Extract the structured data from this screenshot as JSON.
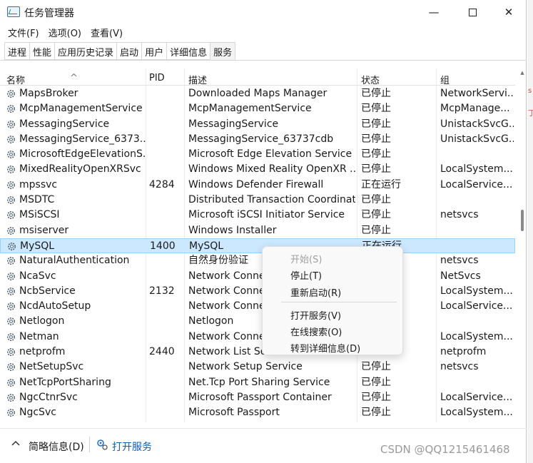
{
  "window": {
    "title": "任务管理器",
    "min_glyph": "—",
    "close_glyph": "✕"
  },
  "menu": [
    "文件(F)",
    "选项(O)",
    "查看(V)"
  ],
  "tabs": [
    {
      "label": "进程",
      "active": false
    },
    {
      "label": "性能",
      "active": false
    },
    {
      "label": "应用历史记录",
      "active": false
    },
    {
      "label": "启动",
      "active": false
    },
    {
      "label": "用户",
      "active": false
    },
    {
      "label": "详细信息",
      "active": false
    },
    {
      "label": "服务",
      "active": true
    }
  ],
  "columns": {
    "name": "名称",
    "pid": "PID",
    "desc": "描述",
    "status": "状态",
    "group": "组",
    "sort_glyph": "^"
  },
  "rows": [
    {
      "name": "MapsBroker",
      "pid": "",
      "desc": "Downloaded Maps Manager",
      "status": "已停止",
      "group": "NetworkServi..."
    },
    {
      "name": "McpManagementService",
      "pid": "",
      "desc": "McpManagementService",
      "status": "已停止",
      "group": "McpManage..."
    },
    {
      "name": "MessagingService",
      "pid": "",
      "desc": "MessagingService",
      "status": "已停止",
      "group": "UnistackSvcG..."
    },
    {
      "name": "MessagingService_6373...",
      "pid": "",
      "desc": "MessagingService_63737cdb",
      "status": "已停止",
      "group": "UnistackSvcG..."
    },
    {
      "name": "MicrosoftEdgeElevationS...",
      "pid": "",
      "desc": "Microsoft Edge Elevation Service ...",
      "status": "已停止",
      "group": ""
    },
    {
      "name": "MixedRealityOpenXRSvc",
      "pid": "",
      "desc": "Windows Mixed Reality OpenXR ...",
      "status": "已停止",
      "group": "LocalSystem..."
    },
    {
      "name": "mpssvc",
      "pid": "4284",
      "desc": "Windows Defender Firewall",
      "status": "正在运行",
      "group": "LocalService..."
    },
    {
      "name": "MSDTC",
      "pid": "",
      "desc": "Distributed Transaction Coordinat...",
      "status": "已停止",
      "group": ""
    },
    {
      "name": "MSiSCSI",
      "pid": "",
      "desc": "Microsoft iSCSI Initiator Service",
      "status": "已停止",
      "group": "netsvcs"
    },
    {
      "name": "msiserver",
      "pid": "",
      "desc": "Windows Installer",
      "status": "已停止",
      "group": ""
    },
    {
      "name": "MySQL",
      "pid": "1400",
      "desc": "MySQL",
      "status": "正在运行",
      "group": "",
      "selected": true
    },
    {
      "name": "NaturalAuthentication",
      "pid": "",
      "desc": "自然身份验证",
      "status": "",
      "group": "netsvcs"
    },
    {
      "name": "NcaSvc",
      "pid": "",
      "desc": "Network Conne...",
      "status": "",
      "group": "NetSvcs"
    },
    {
      "name": "NcbService",
      "pid": "2132",
      "desc": "Network Conne...",
      "status": "",
      "group": "LocalSystem..."
    },
    {
      "name": "NcdAutoSetup",
      "pid": "",
      "desc": "Network Conne...",
      "status": "",
      "group": "LocalService..."
    },
    {
      "name": "Netlogon",
      "pid": "",
      "desc": "Netlogon",
      "status": "",
      "group": ""
    },
    {
      "name": "Netman",
      "pid": "",
      "desc": "Network Conne...",
      "status": "",
      "group": "LocalSystem..."
    },
    {
      "name": "netprofm",
      "pid": "2440",
      "desc": "Network List Ser...",
      "status": "",
      "group": "netprofm"
    },
    {
      "name": "NetSetupSvc",
      "pid": "",
      "desc": "Network Setup Service",
      "status": "已停止",
      "group": "netsvcs"
    },
    {
      "name": "NetTcpPortSharing",
      "pid": "",
      "desc": "Net.Tcp Port Sharing Service",
      "status": "已停止",
      "group": ""
    },
    {
      "name": "NgcCtnrSvc",
      "pid": "",
      "desc": "Microsoft Passport Container",
      "status": "已停止",
      "group": "LocalService..."
    },
    {
      "name": "NgcSvc",
      "pid": "",
      "desc": "Microsoft Passport",
      "status": "已停止",
      "group": "LocalSystem..."
    }
  ],
  "context_menu": {
    "start": "开始(S)",
    "stop": "停止(T)",
    "restart": "重新启动(R)",
    "open_services": "打开服务(V)",
    "search_online": "在线搜索(O)",
    "go_to_details": "转到详细信息(D)"
  },
  "footer": {
    "brief": "简略信息(D)",
    "open_services": "打开服务"
  },
  "watermark": "CSDN @QQ1215461468",
  "side_marks": [
    "s",
    "丁"
  ]
}
